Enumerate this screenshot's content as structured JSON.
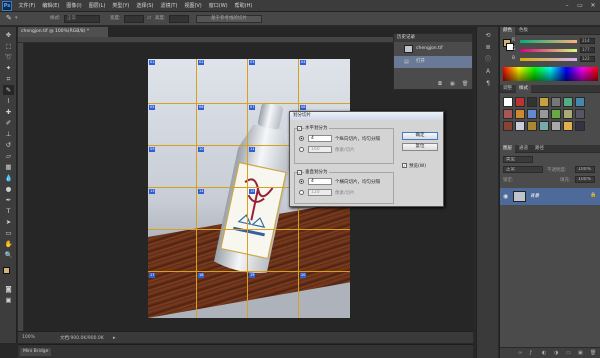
{
  "app": {
    "logo_text": "Ps"
  },
  "menu": [
    "文件(F)",
    "编辑(E)",
    "图像(I)",
    "图层(L)",
    "类型(Y)",
    "选择(S)",
    "滤镜(T)",
    "视图(V)",
    "窗口(W)",
    "帮助(H)"
  ],
  "window_controls": {
    "minimize": "–",
    "restore": "▭",
    "close": "✕"
  },
  "options": {
    "style_label": "样式:",
    "style_value": "正常",
    "width_label": "宽度:",
    "height_label": "高度:",
    "from_guides_button": "基于参考线的切片"
  },
  "document": {
    "tab_title": "chengjon.tif @ 100%(RGB/8) *",
    "zoom": "100%",
    "doc_info": "文档:900.0K/900.0K"
  },
  "slices": {
    "tags": [
      "01",
      "02",
      "03",
      "04",
      "05",
      "06",
      "07",
      "08",
      "09",
      "10",
      "11",
      "12",
      "13",
      "14",
      "15",
      "16",
      "17",
      "18",
      "19",
      "20"
    ],
    "line_color": "#d8a020",
    "tag_color": "#2f5fd8"
  },
  "history_panel": {
    "tabs": [
      "历史记录"
    ],
    "snapshot_name": "chengjon.tif",
    "step_label": "打开"
  },
  "dialog": {
    "title": "划分切片",
    "horizontal_checkbox": "水平划分为",
    "horizontal_count": "4",
    "horizontal_count_unit": "个纵向切片，均匀分隔",
    "horizontal_pixels": "160",
    "horizontal_pixels_unit": "像素/切片",
    "vertical_checkbox": "垂直划分为",
    "vertical_count": "4",
    "vertical_count_unit": "个横向切片，均匀分隔",
    "vertical_pixels": "120",
    "vertical_pixels_unit": "像素/切片",
    "ok_button": "确定",
    "cancel_button": "复位",
    "preview_checkbox": "预览(W)"
  },
  "color_panel": {
    "tabs": [
      "颜色",
      "色板"
    ],
    "channels": [
      {
        "label": "R",
        "value": "214"
      },
      {
        "label": "G",
        "value": "177"
      },
      {
        "label": "B",
        "value": "122"
      }
    ],
    "foreground_color": "#d6b17a"
  },
  "adjust_panel": {
    "tabs": [
      "调整",
      "样式"
    ]
  },
  "layers_panel": {
    "tabs": [
      "图层",
      "通道",
      "路径"
    ],
    "filter_label": "类型",
    "blend_mode": "正常",
    "opacity_label": "不透明度:",
    "opacity_value": "100%",
    "lock_label": "锁定:",
    "fill_label": "填充:",
    "fill_value": "100%",
    "layer_name": "背景"
  },
  "mini_bridge": {
    "tab": "Mini Bridge"
  },
  "colors": {
    "accent": "#2f5fd8",
    "panel_bg": "#4b4b4b",
    "selection_bg": "#4e6a9a"
  }
}
